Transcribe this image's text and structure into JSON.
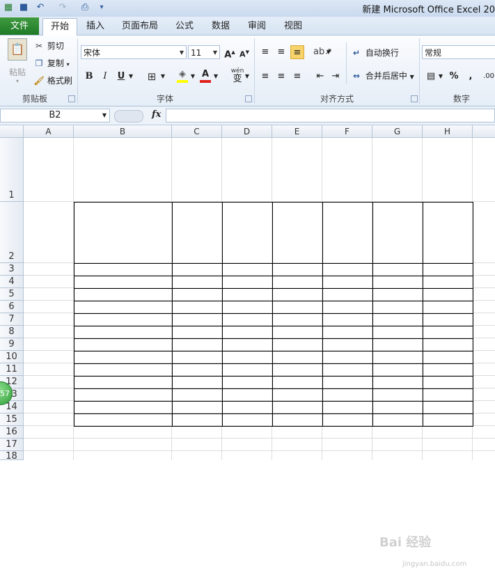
{
  "window": {
    "title": "新建 Microsoft Office Excel 20"
  },
  "quick_access": {
    "icons": [
      "excel-app-icon",
      "save-icon",
      "undo-icon",
      "redo-icon",
      "print-preview-icon",
      "customize-qat-icon"
    ]
  },
  "tabs": [
    {
      "label": "文件",
      "active": false
    },
    {
      "label": "开始",
      "active": true
    },
    {
      "label": "插入",
      "active": false
    },
    {
      "label": "页面布局",
      "active": false
    },
    {
      "label": "公式",
      "active": false
    },
    {
      "label": "数据",
      "active": false
    },
    {
      "label": "审阅",
      "active": false
    },
    {
      "label": "视图",
      "active": false
    }
  ],
  "ribbon": {
    "clipboard": {
      "paste": "粘贴",
      "cut": "剪切",
      "copy": "复制",
      "format_painter": "格式刷",
      "group": "剪贴板"
    },
    "font": {
      "name": "宋体",
      "size": "11",
      "bold": "B",
      "italic": "I",
      "underline": "U",
      "grow": "A",
      "shrink": "A",
      "font_color_letter": "A",
      "phonetic": "wén",
      "phonetic_char": "变",
      "group": "字体"
    },
    "alignment": {
      "wrap": "自动换行",
      "merge": "合并后居中",
      "group": "对齐方式"
    },
    "number": {
      "format": "常规",
      "percent": "%",
      "comma": ",",
      "group": "数字"
    }
  },
  "formula_bar": {
    "name_box": "B2",
    "fx": "fx",
    "value": ""
  },
  "sheet": {
    "columns": [
      "A",
      "B",
      "C",
      "D",
      "E",
      "F",
      "G",
      "H"
    ],
    "rows": [
      "1",
      "2",
      "3",
      "4",
      "5",
      "6",
      "7",
      "8",
      "9",
      "10",
      "11",
      "12",
      "13",
      "14",
      "15",
      "16",
      "17",
      "18"
    ],
    "bordered_range": "B2:H15"
  },
  "overlay": {
    "badge": "57",
    "watermark": "Bai 经验",
    "watermark_url": "jingyan.baidu.com"
  },
  "colors": {
    "file_tab": "#2a8a33",
    "ribbon_bg": "#e5edf7",
    "gridline": "#dadcdd",
    "border": "#000000",
    "active_tab_highlight": "#f7d36a"
  }
}
